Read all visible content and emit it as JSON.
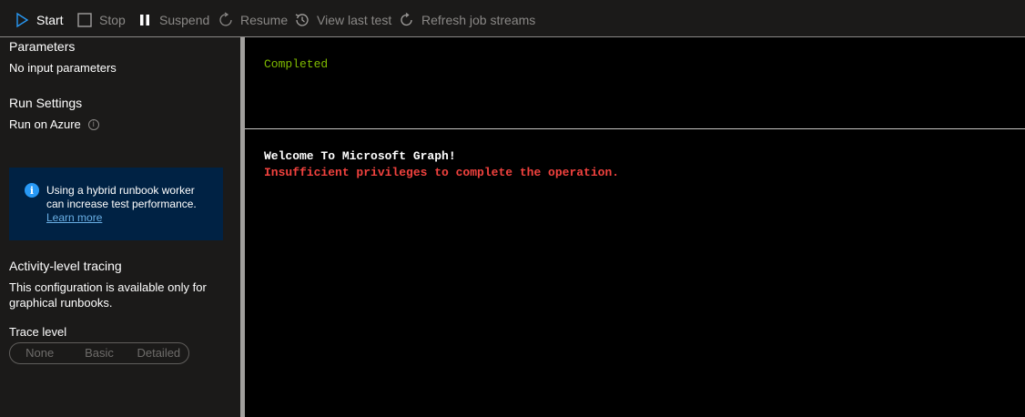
{
  "toolbar": {
    "start": "Start",
    "stop": "Stop",
    "suspend": "Suspend",
    "resume": "Resume",
    "view_last_test": "View last test",
    "refresh_job_streams": "Refresh job streams"
  },
  "left_panel": {
    "parameters_heading": "Parameters",
    "parameters_value": "No input parameters",
    "run_settings_heading": "Run Settings",
    "run_on": "Run on Azure",
    "banner": {
      "line1": "Using a hybrid runbook worker",
      "line2": "can increase test performance.",
      "link": "Learn more"
    },
    "tracing_heading": "Activity-level tracing",
    "tracing_line1": "This configuration is available only for",
    "tracing_line2": "graphical runbooks.",
    "trace_level_label": "Trace level",
    "trace_options": [
      "None",
      "Basic",
      "Detailed"
    ]
  },
  "console": {
    "status": "Completed",
    "output_line1": "Welcome To Microsoft Graph!",
    "error_line": "Insufficient privileges to complete the operation."
  },
  "colors": {
    "accent": "#2899f5",
    "status_green": "#7fba00",
    "error_red": "#f1423e",
    "banner_bg": "#002244"
  },
  "icons": {
    "start": "play-icon",
    "stop": "stop-icon",
    "suspend": "pause-icon",
    "resume": "resume-icon",
    "view_last_test": "history-icon",
    "refresh": "refresh-icon",
    "info": "info-icon"
  }
}
